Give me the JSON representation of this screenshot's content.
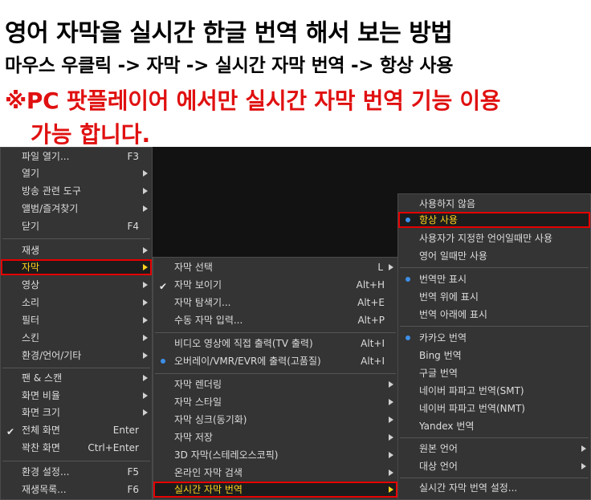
{
  "headings": {
    "title": "영어 자막을 실시간 한글 번역 해서 보는 방법",
    "steps": "마우스 우클릭 -> 자막 -> 실시간 자막 번역 -> 항상 사용",
    "warning_line1": "※PC 팟플레이어 에서만 실시간 자막 번역 기능 이용",
    "warning_line2": "가능 합니다."
  },
  "main_menu": {
    "items": [
      {
        "label": "파일 열기...",
        "shortcut": "F3"
      },
      {
        "label": "열기"
      },
      {
        "label": "방송 관련 도구"
      },
      {
        "label": "앨범/즐겨찾기"
      },
      {
        "label": "닫기",
        "shortcut": "F4"
      },
      {
        "label": "재생"
      },
      {
        "label": "자막"
      },
      {
        "label": "영상"
      },
      {
        "label": "소리"
      },
      {
        "label": "필터"
      },
      {
        "label": "스킨"
      },
      {
        "label": "환경/언어/기타"
      },
      {
        "label": "팬 & 스캔"
      },
      {
        "label": "화면 비율"
      },
      {
        "label": "화면 크기"
      },
      {
        "label": "전체 화면",
        "shortcut": "Enter"
      },
      {
        "label": "꽉찬 화면",
        "shortcut": "Ctrl+Enter"
      },
      {
        "label": "환경 설정...",
        "shortcut": "F5"
      },
      {
        "label": "재생목록...",
        "shortcut": "F6"
      }
    ]
  },
  "subtitle_menu": {
    "items": [
      {
        "label": "자막 선택",
        "shortcut": "L"
      },
      {
        "label": "자막 보이기",
        "shortcut": "Alt+H"
      },
      {
        "label": "자막 탐색기...",
        "shortcut": "Alt+E"
      },
      {
        "label": "수동 자막 입력...",
        "shortcut": "Alt+P"
      },
      {
        "label": "비디오 영상에 직접 출력(TV 출력)",
        "shortcut": "Alt+I"
      },
      {
        "label": "오버레이/VMR/EVR에 출력(고품질)",
        "shortcut": "Alt+I"
      },
      {
        "label": "자막 렌더링"
      },
      {
        "label": "자막 스타일"
      },
      {
        "label": "자막 싱크(동기화)"
      },
      {
        "label": "자막 저장"
      },
      {
        "label": "3D 자막(스테레오스코픽)"
      },
      {
        "label": "온라인 자막 검색"
      },
      {
        "label": "실시간 자막 번역"
      }
    ]
  },
  "translate_menu": {
    "items": [
      {
        "label": "사용하지 않음"
      },
      {
        "label": "항상 사용"
      },
      {
        "label": "사용자가 지정한 언어일때만 사용"
      },
      {
        "label": "영어 일때만 사용"
      },
      {
        "label": "번역만 표시"
      },
      {
        "label": "번역 위에 표시"
      },
      {
        "label": "번역 아래에 표시"
      },
      {
        "label": "카카오 번역"
      },
      {
        "label": "Bing 번역"
      },
      {
        "label": "구글 번역"
      },
      {
        "label": "네이버 파파고 번역(SMT)"
      },
      {
        "label": "네이버 파파고 번역(NMT)"
      },
      {
        "label": "Yandex 번역"
      },
      {
        "label": "원본 언어"
      },
      {
        "label": "대상 언어"
      },
      {
        "label": "실시간 자막 번역 설정..."
      }
    ]
  },
  "colors": {
    "highlight_border": "#e60000",
    "highlight_text": "#ffd21e",
    "radio_dot": "#3d8fe8",
    "warning_text": "#e01010"
  }
}
